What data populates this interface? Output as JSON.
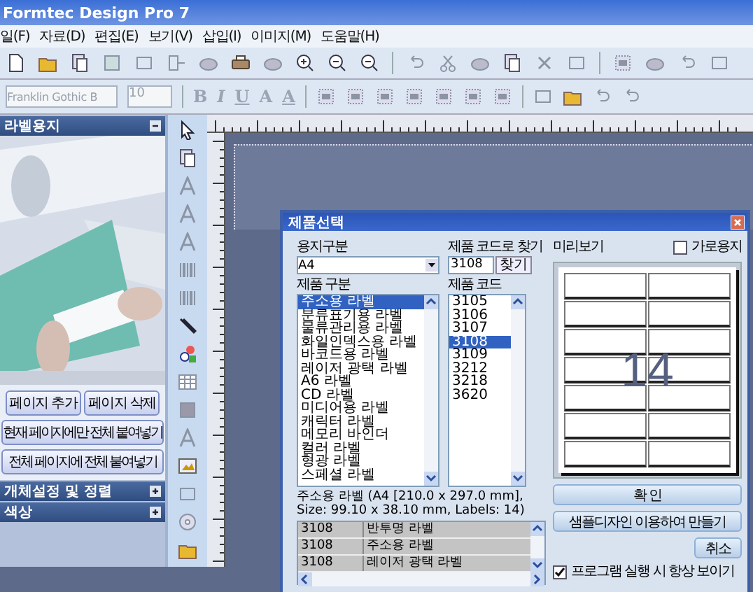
{
  "window": {
    "title": "Formtec Design Pro 7"
  },
  "menu": [
    "일(F)",
    "자료(D)",
    "편집(E)",
    "보기(V)",
    "삽입(I)",
    "이미지(M)",
    "도움말(H)"
  ],
  "format_bar": {
    "font": "Franklin Gothic B",
    "size": "10",
    "style_buttons": [
      "B",
      "I",
      "U",
      "A",
      "A"
    ]
  },
  "left_panel": {
    "title": "라벨용지",
    "buttons": [
      "페이지 추가",
      "페이지 삭제",
      "현재 페이지에만 전체 붙여넣기",
      "전체 페이지에 전체 붙여넣기"
    ],
    "sections": [
      "개체설정 및 정렬",
      "색상"
    ]
  },
  "dialog": {
    "title": "제품선택",
    "paper_label": "용지구분",
    "paper": "A4",
    "find_label": "제품 코드로 찾기",
    "find_value": "3108",
    "find_button": "찾기",
    "categories": {
      "label": "제품 구분",
      "items": [
        {
          "label": "주소용 라벨",
          "selected": true
        },
        {
          "label": "분류표기용 라벨",
          "selected": false
        },
        {
          "label": "물류관리용 라벨",
          "selected": false
        },
        {
          "label": "화일인덱스용 라벨",
          "selected": false
        },
        {
          "label": "바코드용 라벨",
          "selected": false
        },
        {
          "label": "레이저 광택 라벨",
          "selected": false
        },
        {
          "label": "A6 라벨",
          "selected": false
        },
        {
          "label": "CD 라벨",
          "selected": false
        },
        {
          "label": "미디어용 라벨",
          "selected": false
        },
        {
          "label": "캐릭터 라벨",
          "selected": false
        },
        {
          "label": "메모리 바인더",
          "selected": false
        },
        {
          "label": "컬러 라벨",
          "selected": false
        },
        {
          "label": "형광 라벨",
          "selected": false
        },
        {
          "label": "스페셜 라벨",
          "selected": false
        }
      ]
    },
    "codes": {
      "label": "제품 코드",
      "items": [
        {
          "label": "3105",
          "selected": false
        },
        {
          "label": "3106",
          "selected": false
        },
        {
          "label": "3107",
          "selected": false
        },
        {
          "label": "3108",
          "selected": true
        },
        {
          "label": "3109",
          "selected": false
        },
        {
          "label": "3212",
          "selected": false
        },
        {
          "label": "3218",
          "selected": false
        },
        {
          "label": "3620",
          "selected": false
        }
      ]
    },
    "info": "주소용 라벨 (A4 [210.0 x 297.0 mm], Size: 99.10 x 38.10 mm, Labels: 14)",
    "results": [
      {
        "code": "3108",
        "name": "반투명 라벨"
      },
      {
        "code": "3108",
        "name": "주소용 라벨"
      },
      {
        "code": "3108",
        "name": "레이저 광택 라벨"
      }
    ],
    "preview": {
      "label": "미리보기",
      "count": "14"
    },
    "landscape": {
      "label": "가로용지",
      "checked": false
    },
    "buttons": [
      {
        "label": "확 인",
        "kind": "wide"
      },
      {
        "label": "샘플디자인 이용하여 만들기",
        "kind": "wide"
      },
      {
        "label": "취소",
        "kind": "small"
      }
    ],
    "always_show": {
      "label": "프로그램 실행 시 항상 보이기",
      "checked": true
    }
  }
}
